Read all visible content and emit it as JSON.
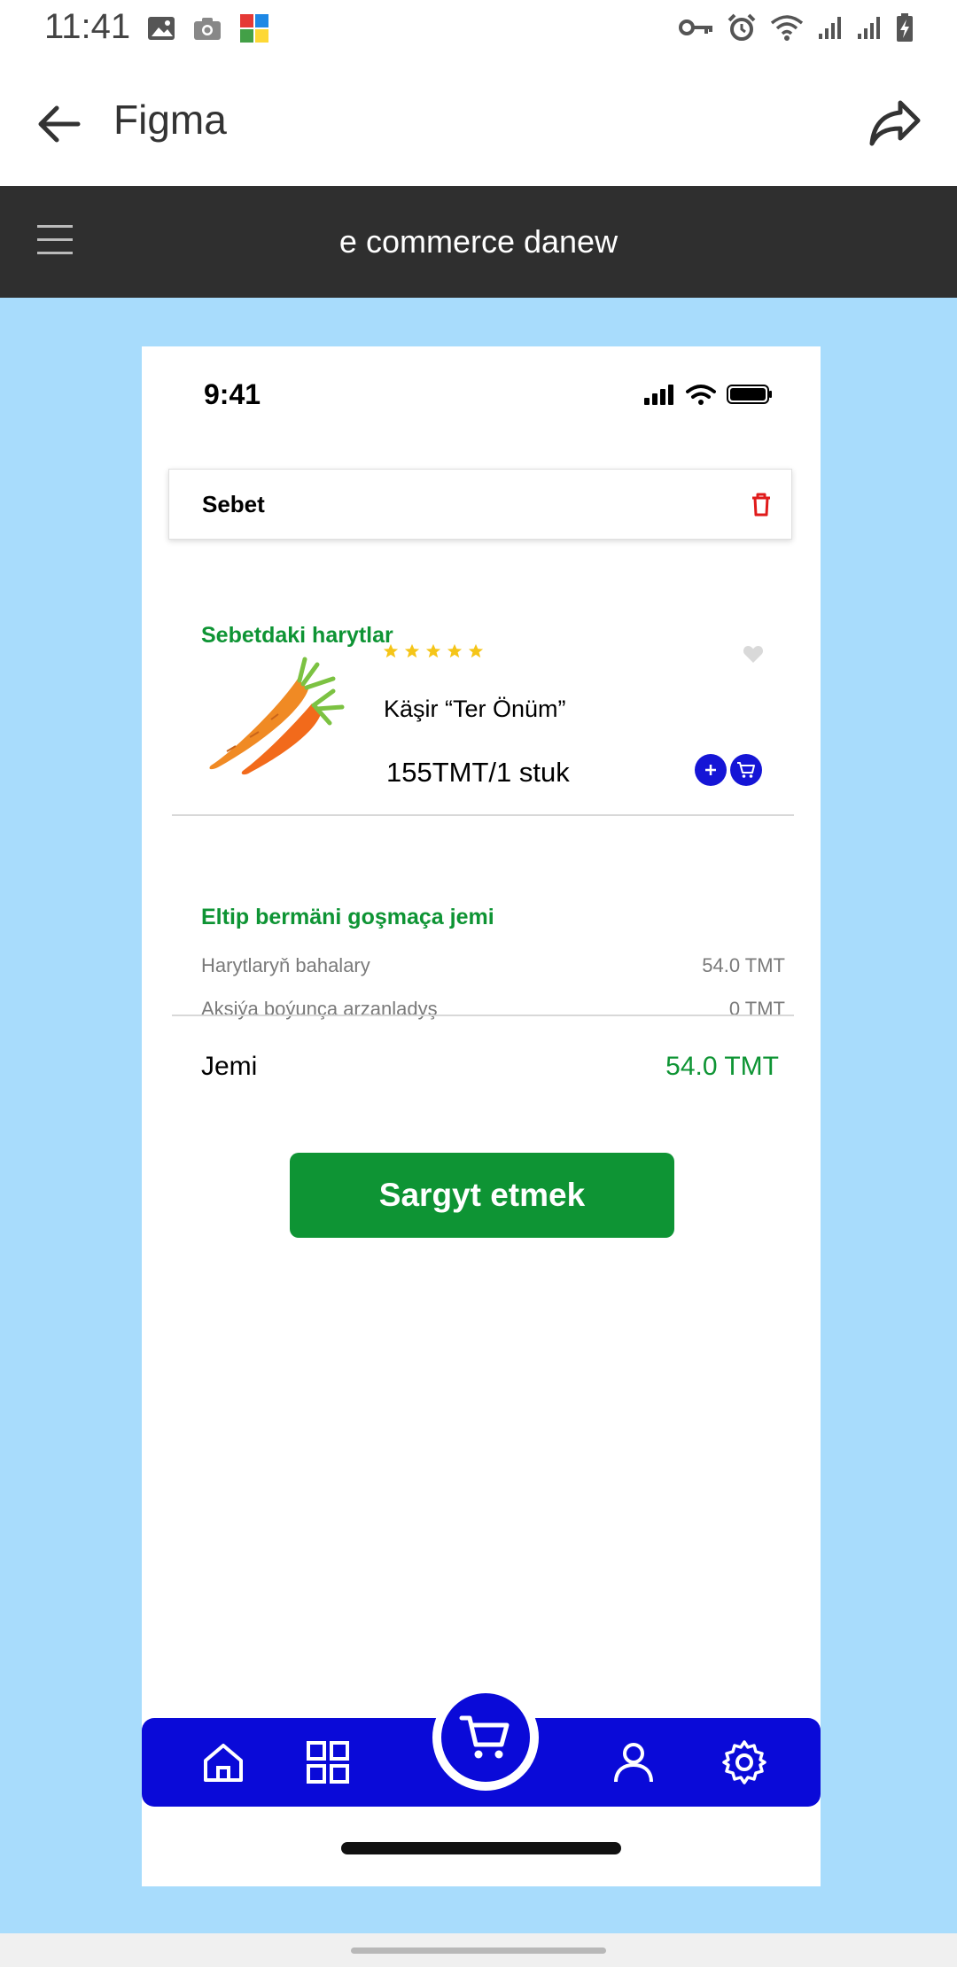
{
  "android_status": {
    "time": "11:41"
  },
  "app_bar": {
    "title": "Figma"
  },
  "figma_header": {
    "title": "e commerce danew"
  },
  "phone": {
    "status_time": "9:41"
  },
  "cart": {
    "title": "Sebet",
    "section_items_title": "Sebetdaki harytlar",
    "product": {
      "name": "Käşir “Ter Önüm”",
      "price": "155TMT/1 stuk",
      "rating_stars": 5
    },
    "delivery_section_title": "Eltip bermäni goşmaça jemi",
    "rows": [
      {
        "label": "Harytlaryň bahalary",
        "value": "54.0 TMT"
      },
      {
        "label": "Aksiýa boýunça arzanladyş",
        "value": "0 TMT"
      }
    ],
    "total_label": "Jemi",
    "total_value": "54.0 TMT",
    "order_button": "Sargyt etmek"
  },
  "colors": {
    "accent_green": "#0e9434",
    "nav_blue": "#0a0ad8",
    "canvas_bg": "#a8dcfc",
    "header_dark": "#2f2f2f",
    "trash_red": "#e01b1b",
    "star_yellow": "#f5c518"
  },
  "icons": {
    "back": "arrow-left-icon",
    "share": "share-icon",
    "menu": "hamburger-icon",
    "trash": "trash-icon",
    "heart": "heart-icon",
    "plus": "plus-icon",
    "cart": "cart-icon",
    "home": "home-icon",
    "grid": "grid-icon",
    "user": "user-icon",
    "settings": "gear-icon"
  }
}
